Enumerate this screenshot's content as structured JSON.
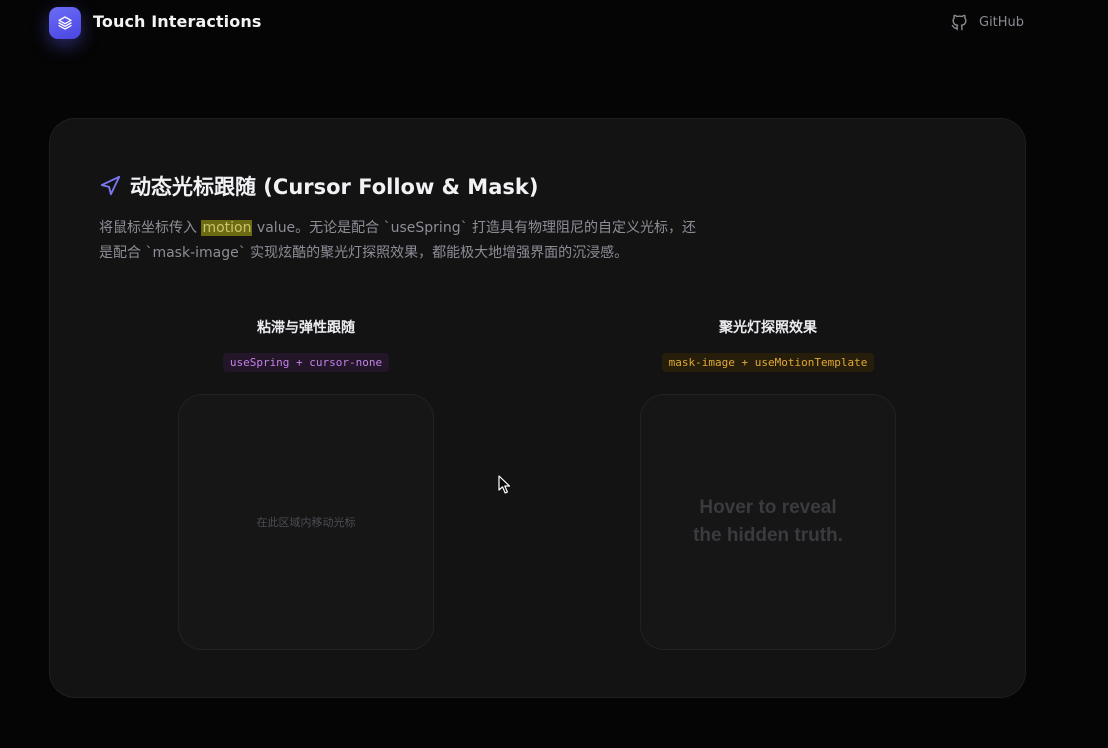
{
  "header": {
    "app_name": "Touch Interactions",
    "logo_icon": "layers-icon",
    "github_label": "GitHub",
    "github_icon": "github-icon"
  },
  "section": {
    "icon": "navigation-arrow-icon",
    "title": "动态光标跟随 (Cursor Follow & Mask)",
    "desc_prefix": "将鼠标坐标传入 ",
    "desc_highlight": "motion",
    "desc_line1_rest": " value。无论是配合 `useSpring` 打造具有物理阻尼的自定义光标，还",
    "desc_line2": "是配合 `mask-image` 实现炫酷的聚光灯探照效果，都能极大地增强界面的沉浸感。"
  },
  "demos": [
    {
      "title": "粘滞与弹性跟随",
      "tag": "useSpring + cursor-none",
      "hint": "在此区域内移动光标"
    },
    {
      "title": "聚光灯探照效果",
      "tag": "mask-image + useMotionTemplate",
      "reveal_line1": "Hover to reveal",
      "reveal_line2": "the hidden truth."
    }
  ],
  "colors": {
    "accent": "#5b58ee",
    "tag_purple": "#c482e8",
    "tag_amber": "#e0a838",
    "highlight_bg": "#6d6a14"
  }
}
